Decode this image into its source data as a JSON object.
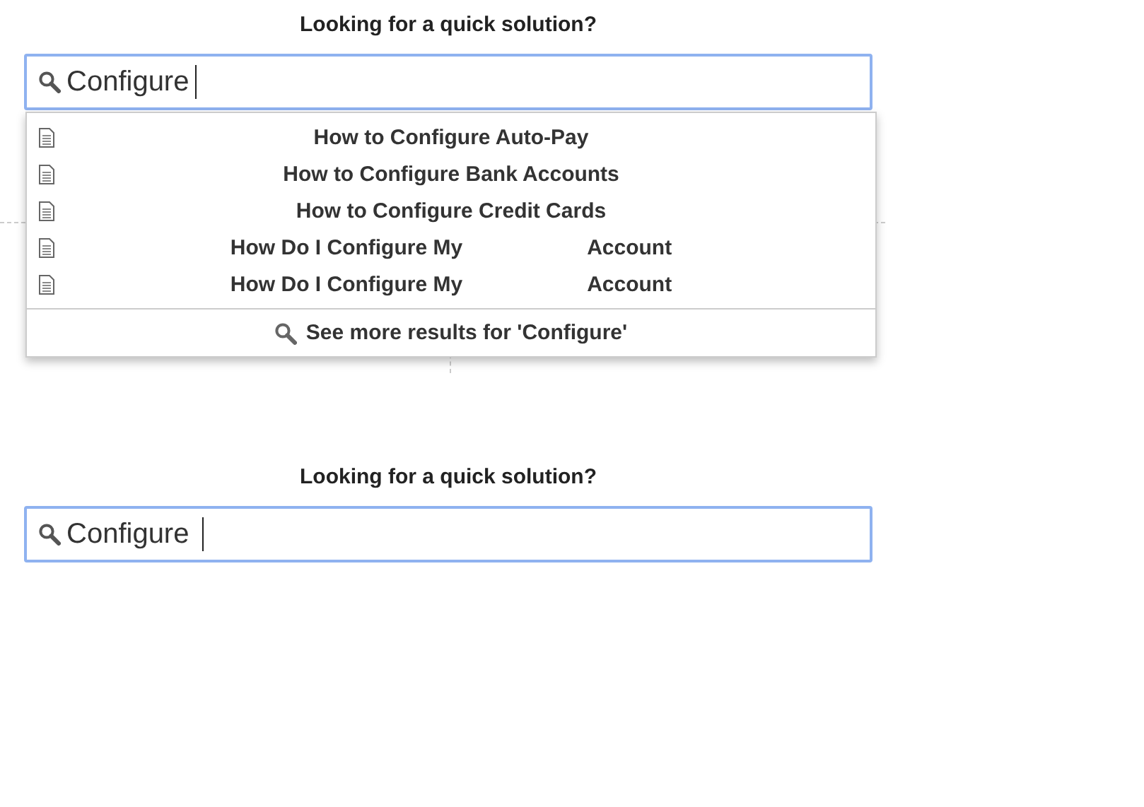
{
  "sections": [
    {
      "title": "Looking for a quick solution?",
      "search": {
        "value": "Configure",
        "focused": true
      },
      "suggestions": {
        "items": [
          {
            "parts": [
              "How to Configure Auto-Pay"
            ]
          },
          {
            "parts": [
              "How to Configure Bank Accounts"
            ]
          },
          {
            "parts": [
              "How to Configure Credit Cards"
            ]
          },
          {
            "parts": [
              "How Do I Configure My",
              "Account"
            ]
          },
          {
            "parts": [
              "How Do I Configure My",
              "Account"
            ]
          }
        ],
        "more": "See more results for 'Configure'"
      }
    },
    {
      "title": "Looking for a quick solution?",
      "search": {
        "value": "Configure ",
        "focused": true
      }
    }
  ]
}
